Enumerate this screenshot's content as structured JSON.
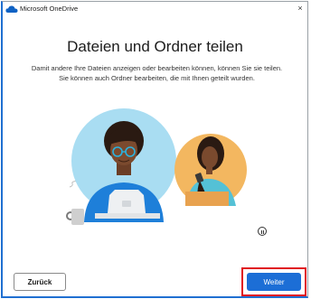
{
  "window": {
    "title": "Microsoft OneDrive",
    "close_glyph": "×"
  },
  "main": {
    "heading": "Dateien und Ordner teilen",
    "description_line1": "Damit andere Ihre Dateien anzeigen oder bearbeiten können, können Sie sie teilen.",
    "description_line2": "Sie können auch Ordner bearbeiten, die mit Ihnen geteilt wurden."
  },
  "footer": {
    "back_label": "Zurück",
    "next_label": "Weiter"
  },
  "icons": {
    "app": "onedrive-cloud-icon",
    "close": "close-icon",
    "pause": "pause-icon"
  },
  "colors": {
    "accent": "#1c6ed6",
    "highlight_frame": "#e0141e",
    "person1_bg": "#a9ddf2",
    "person2_bg": "#f3b760"
  }
}
